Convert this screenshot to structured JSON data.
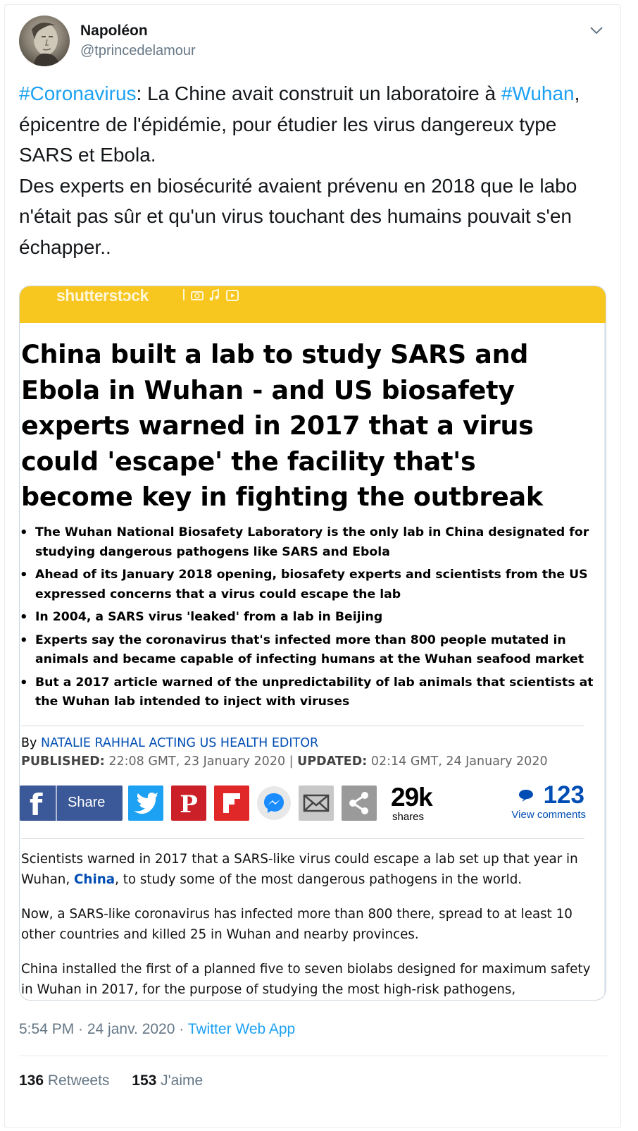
{
  "tweet": {
    "author_name": "Napoléon",
    "author_handle": "@tprincedelamour",
    "text_parts": {
      "hashtag1": "#Coronavirus",
      "text1": ": La Chine avait construit un laboratoire à ",
      "hashtag2": "#Wuhan",
      "text2": ", épicentre de l'épidémie, pour étudier les virus dangereux type SARS et Ebola.",
      "line2": "Des experts en biosécurité avaient prévenu en 2018 que le labo n'était pas sûr et qu'un virus touchant des humains pouvait s'en échapper.."
    },
    "timestamp": "5:54 PM · 24 janv. 2020",
    "separator": " · ",
    "source": "Twitter Web App",
    "retweets_count": "136",
    "retweets_label": "Retweets",
    "likes_count": "153",
    "likes_label": "J'aime"
  },
  "media": {
    "watermark": "shutterstɔck",
    "headline": "China built a lab to study SARS and Ebola in Wuhan - and US biosafety experts warned in 2017 that a virus could 'escape' the facility that's become key in fighting the outbreak",
    "bullets": [
      "The Wuhan National Biosafety Laboratory is the only lab in China designated for studying dangerous pathogens like SARS and Ebola",
      "Ahead of its January 2018 opening, biosafety experts and scientists from the US expressed concerns that a virus could escape the lab",
      "In 2004, a SARS virus 'leaked' from a lab in Beijing",
      "Experts say the coronavirus that's infected more than 800 people mutated in animals and became capable of infecting humans at the Wuhan seafood market",
      "But a 2017 article warned of the unpredictability of lab animals that scientists at the Wuhan lab intended to inject with viruses"
    ],
    "byline_prefix": "By ",
    "byline_author": "NATALIE RAHHAL ACTING US HEALTH EDITOR",
    "published_label": "PUBLISHED:",
    "published_value": " 22:08 GMT, 23 January 2020 | ",
    "updated_label": "UPDATED:",
    "updated_value": " 02:14 GMT, 24 January 2020",
    "share_label": "Share",
    "shares_count": "29k",
    "shares_label": "shares",
    "comments_count": "123",
    "comments_label": "View comments",
    "para1_a": "Scientists warned in 2017 that a SARS-like virus could escape a lab set up that year in Wuhan, ",
    "para1_link": "China",
    "para1_b": ", to study some of the most dangerous pathogens in the world.",
    "para2": "Now, a SARS-like coronavirus has infected more than 800 there, spread to at least 10 other countries and killed 25 in Wuhan and nearby provinces.",
    "para3": "China installed the first of a planned five to seven biolabs designed for maximum safety in Wuhan in 2017, for the purpose of studying the most high-risk pathogens,"
  },
  "colors": {
    "twitter_blue": "#1da1f2",
    "shutterstock_yellow": "#f7c61f",
    "dailymail_link": "#004db3",
    "facebook": "#3b5998",
    "pinterest": "#cb2027",
    "flipboard": "#e12828"
  },
  "icons": [
    "chevron-down-icon",
    "camera-icon",
    "music-icon",
    "video-icon",
    "facebook-icon",
    "twitter-icon",
    "pinterest-icon",
    "flipboard-icon",
    "messenger-icon",
    "mail-icon",
    "share-icon",
    "comment-bubble-icon"
  ]
}
